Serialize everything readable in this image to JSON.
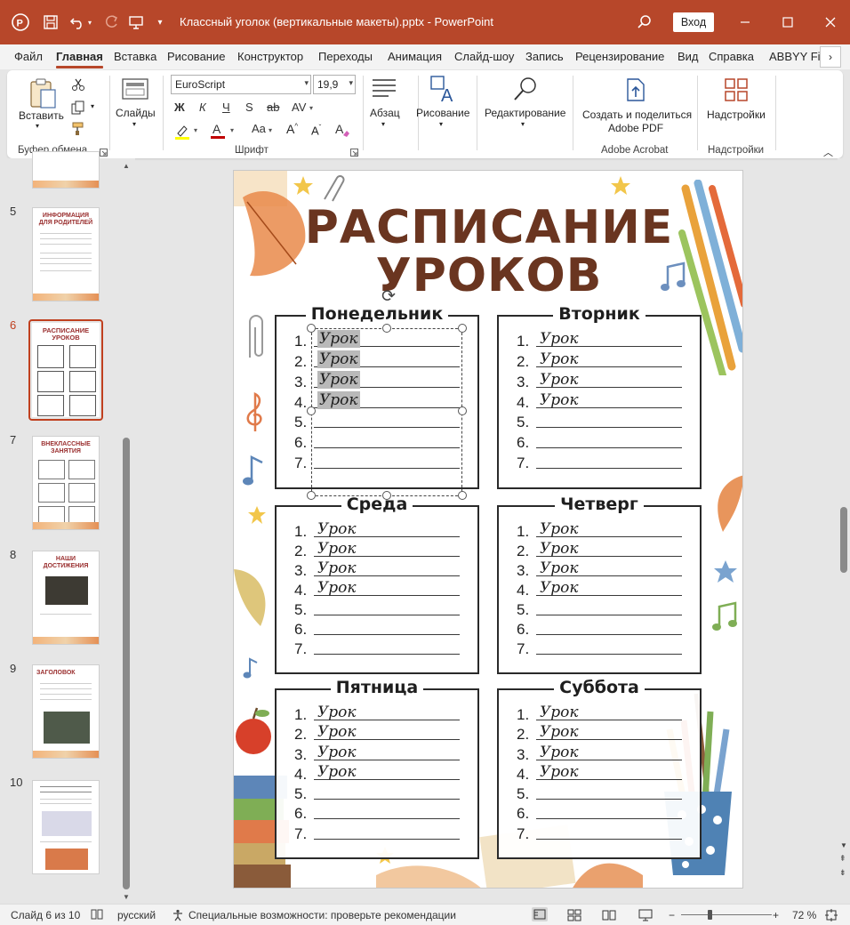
{
  "app": {
    "document_title": "Классный уголок (вертикальные макеты).pptx  -  PowerPoint",
    "signin_label": "Вход"
  },
  "menu": {
    "tabs": [
      "Файл",
      "Главная",
      "Вставка",
      "Рисование",
      "Конструктор",
      "Переходы",
      "Анимация",
      "Слайд-шоу",
      "Запись",
      "Рецензирование",
      "Вид",
      "Справка",
      "ABBYY Fin"
    ],
    "active_tab": "Главная"
  },
  "ribbon": {
    "clipboard": {
      "paste_label": "Вставить",
      "group_label": "Буфер обмена"
    },
    "slides": {
      "label": "Слайды"
    },
    "font": {
      "font_name": "EuroScript",
      "font_size": "19,9",
      "bold_glyph": "Ж",
      "italic_glyph": "К",
      "underline_glyph": "Ч",
      "strike_glyph": "S",
      "strike2_glyph": "ab",
      "spacing_glyph": "AV",
      "case_glyph": "Aa",
      "group_label": "Шрифт"
    },
    "paragraph": {
      "label": "Абзац"
    },
    "drawing": {
      "label": "Рисование"
    },
    "editing": {
      "label": "Редактирование"
    },
    "acrobat": {
      "label_line1": "Создать и поделиться",
      "label_line2": "Adobe PDF",
      "group_label": "Adobe Acrobat"
    },
    "addins": {
      "label": "Надстройки",
      "group_label": "Надстройки"
    },
    "colors": {
      "highlight": "#ffff00",
      "font_color": "#c00000"
    }
  },
  "thumbnails": {
    "visible_numbers": [
      "5",
      "6",
      "7",
      "8",
      "9",
      "10"
    ],
    "active": "6",
    "items": [
      {
        "num": "5",
        "title": "ИНФОРМАЦИЯ ДЛЯ РОДИТЕЛЕЙ"
      },
      {
        "num": "6",
        "title": "РАСПИСАНИЕ УРОКОВ"
      },
      {
        "num": "7",
        "title": "ВНЕКЛАССНЫЕ ЗАНЯТИЯ"
      },
      {
        "num": "8",
        "title": "НАШИ ДОСТИЖЕНИЯ"
      },
      {
        "num": "9",
        "title": "ЗАГОЛОВОК"
      },
      {
        "num": "10",
        "title": ""
      }
    ]
  },
  "slide": {
    "title_line1": "РАСПИСАНИЕ",
    "title_line2": "УРОКОВ",
    "lesson_word": "Урок",
    "lesson_numbers": [
      "1.",
      "2.",
      "3.",
      "4.",
      "5.",
      "6.",
      "7."
    ],
    "days": [
      {
        "name": "Понедельник",
        "filled": 4,
        "selected": true
      },
      {
        "name": "Вторник",
        "filled": 4,
        "selected": false
      },
      {
        "name": "Среда",
        "filled": 4,
        "selected": false
      },
      {
        "name": "Четверг",
        "filled": 4,
        "selected": false
      },
      {
        "name": "Пятница",
        "filled": 4,
        "selected": false
      },
      {
        "name": "Суббота",
        "filled": 4,
        "selected": false
      }
    ],
    "accent_title_color": "#6a3520"
  },
  "status": {
    "slide_counter": "Слайд 6 из 10",
    "language": "русский",
    "accessibility": "Специальные возможности: проверьте рекомендации",
    "zoom": "72 %"
  },
  "theme": {
    "title_bar": "#b7472a",
    "accent": "#c0401f"
  }
}
